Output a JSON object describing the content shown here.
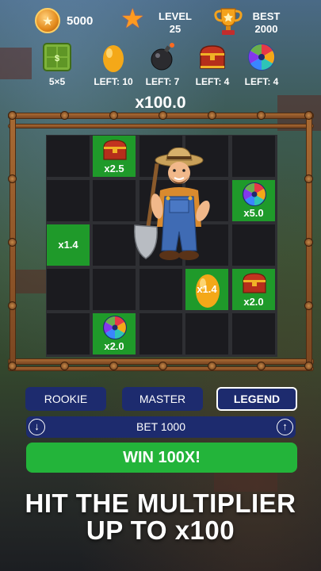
{
  "stats": {
    "coins": "5000",
    "level_label": "LEVEL",
    "level_value": "25",
    "best_label": "BEST",
    "best_value": "2000"
  },
  "items": [
    {
      "icon": "grid-box-icon",
      "label": "5×5"
    },
    {
      "icon": "golden-egg-icon",
      "label": "LEFT: 10"
    },
    {
      "icon": "bomb-icon",
      "label": "LEFT: 7"
    },
    {
      "icon": "treasure-chest-icon",
      "label": "LEFT: 4"
    },
    {
      "icon": "prize-wheel-icon",
      "label": "LEFT: 4"
    }
  ],
  "multiplier": "x100.0",
  "board": {
    "size": "5x5",
    "revealed": [
      {
        "row": 1,
        "col": 2,
        "item": "treasure-chest",
        "mult": "x2.5"
      },
      {
        "row": 2,
        "col": 5,
        "item": "prize-wheel",
        "mult": "x5.0"
      },
      {
        "row": 3,
        "col": 1,
        "item": "egg-plain",
        "mult": "x1.4"
      },
      {
        "row": 4,
        "col": 4,
        "item": "golden-egg",
        "mult": "x1.4"
      },
      {
        "row": 4,
        "col": 5,
        "item": "treasure-chest",
        "mult": "x2.0"
      },
      {
        "row": 5,
        "col": 2,
        "item": "prize-wheel",
        "mult": "x2.0"
      }
    ]
  },
  "difficulty": {
    "rookie": "ROOKIE",
    "master": "MASTER",
    "legend": "LEGEND",
    "selected": "LEGEND"
  },
  "bet": {
    "label": "BET 1000",
    "decrease": "↓",
    "increase": "↑"
  },
  "win_button": "WIN 100X!",
  "headline_1": "HIT THE MULTIPLIER",
  "headline_2": "UP TO x100",
  "colors": {
    "win_green": "#23b43a",
    "cell_green": "#1f9a2a",
    "button_navy": "#1d2b6e",
    "cell_dark": "#1b1b1f"
  }
}
